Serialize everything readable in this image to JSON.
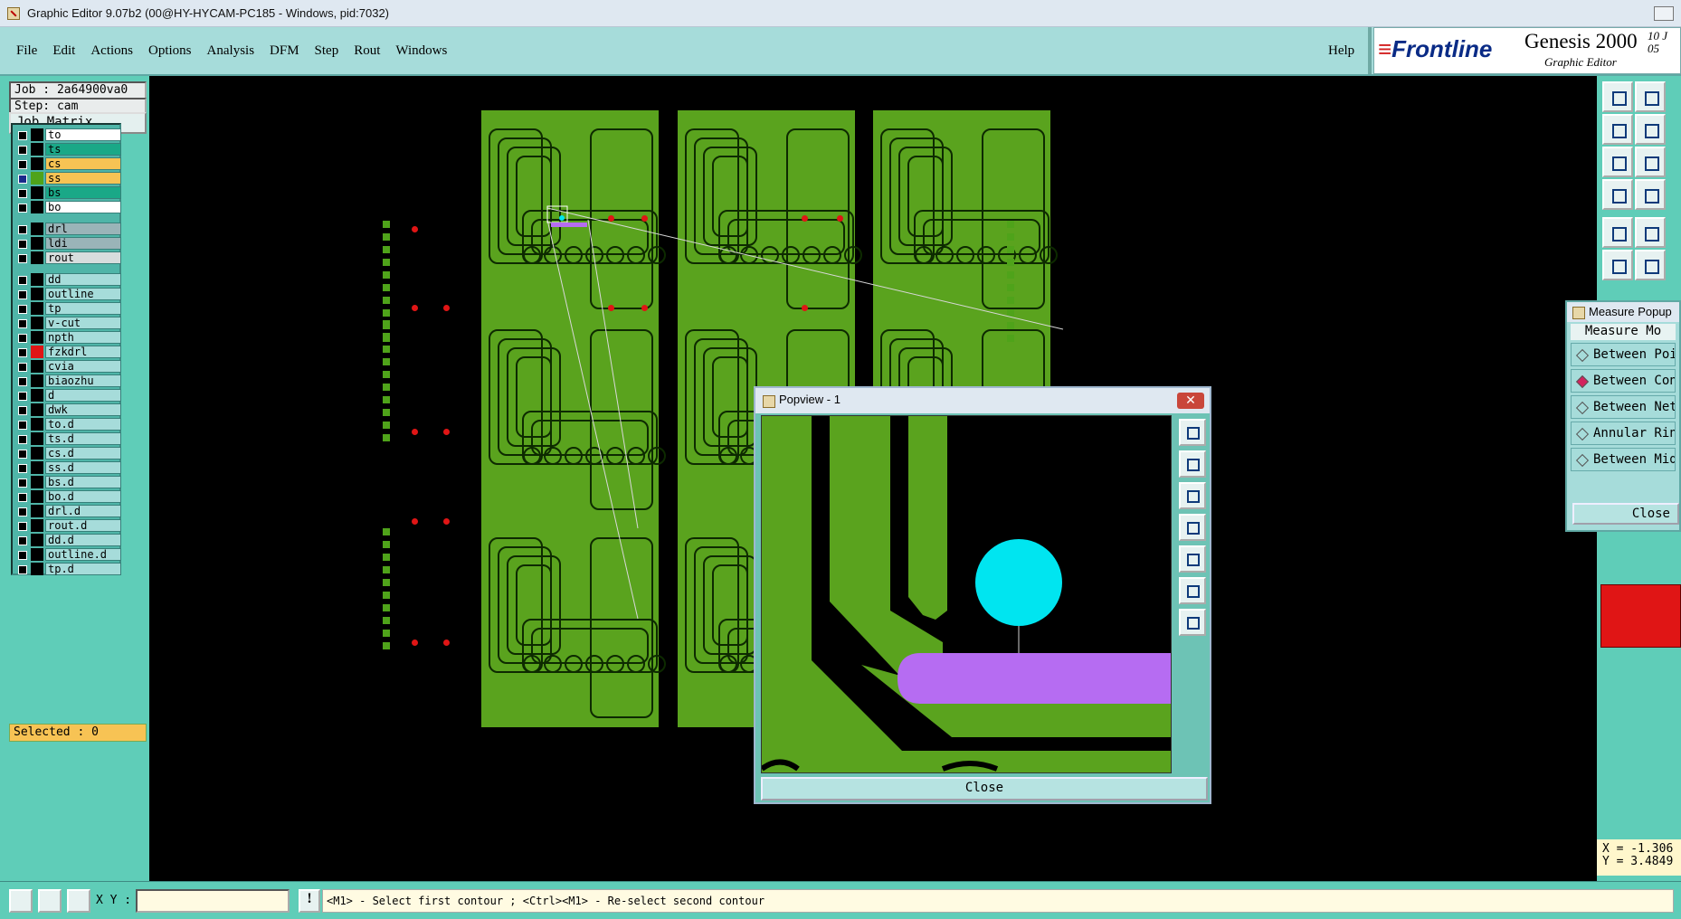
{
  "window": {
    "title": "Graphic Editor 9.07b2 (00@HY-HYCAM-PC185 - Windows, pid:7032)"
  },
  "menu": {
    "items": [
      "File",
      "Edit",
      "Actions",
      "Options",
      "Analysis",
      "DFM",
      "Step",
      "Rout",
      "Windows"
    ],
    "help": "Help"
  },
  "brand": {
    "logo": "Frontline",
    "product": "Genesis 2000",
    "subtitle": "Graphic Editor",
    "date_line1": "10 J",
    "date_line2": "05"
  },
  "job": {
    "job_label": "Job : 2a64900va0",
    "step_label": "Step: cam",
    "matrix_button": "Job Matrix ..."
  },
  "layers": [
    {
      "name": "to",
      "bg": "#ffffff",
      "color": "#000000",
      "gap": false
    },
    {
      "name": "ts",
      "bg": "#1aa887",
      "color": "#000000",
      "gap": false
    },
    {
      "name": "cs",
      "bg": "#f7c354",
      "color": "#000000",
      "gap": false
    },
    {
      "name": "ss",
      "bg": "#f7c354",
      "color": "#4fa31a",
      "gap": false,
      "checked_color": "#1a2a8a"
    },
    {
      "name": "bs",
      "bg": "#1aa887",
      "color": "#000000",
      "gap": false
    },
    {
      "name": "bo",
      "bg": "#ffffff",
      "color": "#000000",
      "gap": false
    },
    {
      "name": "drl",
      "bg": "#9ab4b8",
      "color": "#000000",
      "gap": true
    },
    {
      "name": "ldi",
      "bg": "#9ab4b8",
      "color": "#000000",
      "gap": false
    },
    {
      "name": "rout",
      "bg": "#d7dddd",
      "color": "#000000",
      "gap": false
    },
    {
      "name": "dd",
      "bg": "#a6dcda",
      "color": "#000000",
      "gap": true
    },
    {
      "name": "outline",
      "bg": "#a6dcda",
      "color": "#000000",
      "gap": false
    },
    {
      "name": "tp",
      "bg": "#a6dcda",
      "color": "#000000",
      "gap": false
    },
    {
      "name": "v-cut",
      "bg": "#a6dcda",
      "color": "#000000",
      "gap": false
    },
    {
      "name": "npth",
      "bg": "#a6dcda",
      "color": "#000000",
      "gap": false
    },
    {
      "name": "fzkdrl",
      "bg": "#a6dcda",
      "color": "#e01515",
      "gap": false
    },
    {
      "name": "cvia",
      "bg": "#a6dcda",
      "color": "#000000",
      "gap": false
    },
    {
      "name": "biaozhu",
      "bg": "#a6dcda",
      "color": "#000000",
      "gap": false
    },
    {
      "name": "d",
      "bg": "#a6dcda",
      "color": "#000000",
      "gap": false
    },
    {
      "name": "dwk",
      "bg": "#a6dcda",
      "color": "#000000",
      "gap": false
    },
    {
      "name": "to.d",
      "bg": "#a6dcda",
      "color": "#000000",
      "gap": false
    },
    {
      "name": "ts.d",
      "bg": "#a6dcda",
      "color": "#000000",
      "gap": false
    },
    {
      "name": "cs.d",
      "bg": "#a6dcda",
      "color": "#000000",
      "gap": false
    },
    {
      "name": "ss.d",
      "bg": "#a6dcda",
      "color": "#000000",
      "gap": false
    },
    {
      "name": "bs.d",
      "bg": "#a6dcda",
      "color": "#000000",
      "gap": false
    },
    {
      "name": "bo.d",
      "bg": "#a6dcda",
      "color": "#000000",
      "gap": false
    },
    {
      "name": "drl.d",
      "bg": "#a6dcda",
      "color": "#000000",
      "gap": false
    },
    {
      "name": "rout.d",
      "bg": "#a6dcda",
      "color": "#000000",
      "gap": false
    },
    {
      "name": "dd.d",
      "bg": "#a6dcda",
      "color": "#000000",
      "gap": false
    },
    {
      "name": "outline.d",
      "bg": "#a6dcda",
      "color": "#000000",
      "gap": false
    },
    {
      "name": "tp.d",
      "bg": "#a6dcda",
      "color": "#000000",
      "gap": false
    }
  ],
  "selected": "Selected : 0",
  "measure": {
    "title": "Measure Popup",
    "mode_header": "Measure Mo",
    "options": [
      {
        "label": "Between Poi",
        "selected": false
      },
      {
        "label": "Between Con",
        "selected": true
      },
      {
        "label": "Between Net",
        "selected": false
      },
      {
        "label": "Annular Rin",
        "selected": false
      },
      {
        "label": "Between Mid",
        "selected": false
      }
    ],
    "close": "Close"
  },
  "popview": {
    "title": "Popview - 1",
    "close": "Close",
    "close_x": "✕"
  },
  "coords": {
    "x": "X = -1.306",
    "y": "Y = 3.4849"
  },
  "status": {
    "xy_label": "X Y :",
    "xy_value": "",
    "warn": "!",
    "prompt": "<M1> - Select first contour ; <Ctrl><M1> - Re-select second contour"
  },
  "colors": {
    "pcb_green": "#5aa31e",
    "pad_cyan": "#00e5f0",
    "purple_trace": "#b66cf2",
    "measure_red": "#e01515"
  }
}
